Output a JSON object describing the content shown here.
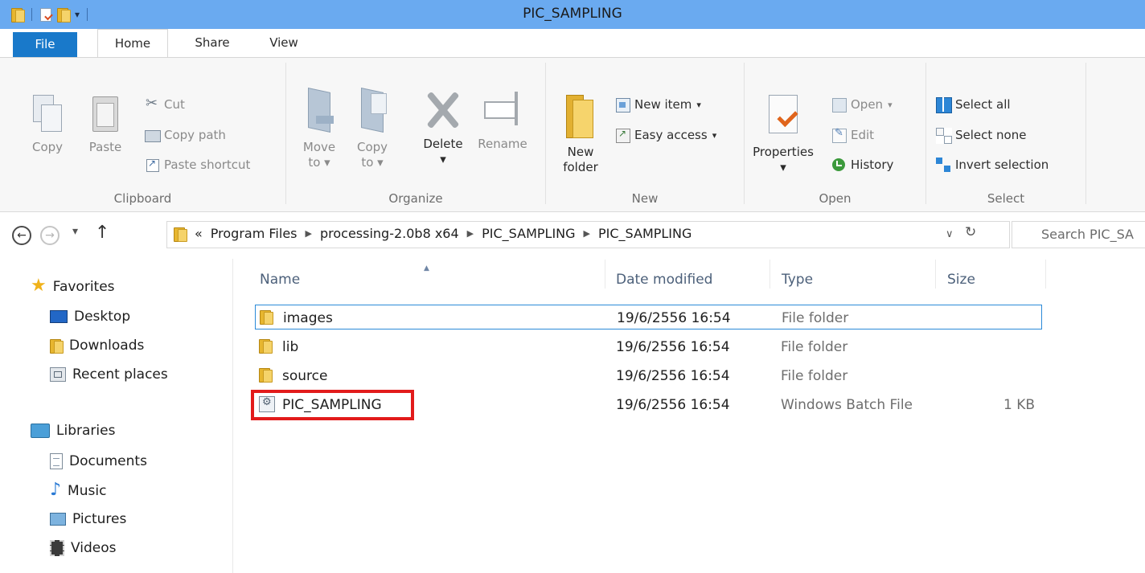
{
  "window": {
    "title": "PIC_SAMPLING"
  },
  "tabs": [
    {
      "label": "File"
    },
    {
      "label": "Home"
    },
    {
      "label": "Share"
    },
    {
      "label": "View"
    }
  ],
  "ribbon": {
    "clipboard": {
      "label": "Clipboard",
      "copy": "Copy",
      "paste": "Paste",
      "cut": "Cut",
      "copy_path": "Copy path",
      "paste_shortcut": "Paste shortcut"
    },
    "organize": {
      "label": "Organize",
      "move_to": [
        "Move",
        "to"
      ],
      "copy_to": [
        "Copy",
        "to"
      ],
      "delete": "Delete",
      "rename": "Rename"
    },
    "new": {
      "label": "New",
      "new_folder": [
        "New",
        "folder"
      ],
      "new_item": "New item",
      "easy_access": "Easy access"
    },
    "open": {
      "label": "Open",
      "properties": "Properties",
      "open": "Open",
      "edit": "Edit",
      "history": "History"
    },
    "select": {
      "label": "Select",
      "select_all": "Select all",
      "select_none": "Select none",
      "invert_selection": "Invert selection"
    }
  },
  "address": {
    "overflow": "«",
    "crumbs": [
      "Program Files",
      "processing-2.0b8 x64",
      "PIC_SAMPLING",
      "PIC_SAMPLING"
    ],
    "search_placeholder": "Search PIC_SA"
  },
  "nav_pane": {
    "favorites": "Favorites",
    "desktop": "Desktop",
    "downloads": "Downloads",
    "recent_places": "Recent places",
    "libraries": "Libraries",
    "documents": "Documents",
    "music": "Music",
    "pictures": "Pictures",
    "videos": "Videos"
  },
  "columns": {
    "name": "Name",
    "date": "Date modified",
    "type": "Type",
    "size": "Size"
  },
  "files": [
    {
      "name": "images",
      "date": "19/6/2556 16:54",
      "type": "File folder",
      "size": ""
    },
    {
      "name": "lib",
      "date": "19/6/2556 16:54",
      "type": "File folder",
      "size": ""
    },
    {
      "name": "source",
      "date": "19/6/2556 16:54",
      "type": "File folder",
      "size": ""
    },
    {
      "name": "PIC_SAMPLING",
      "date": "19/6/2556 16:54",
      "type": "Windows Batch File",
      "size": "1 KB"
    }
  ],
  "colors": {
    "titlebar": "#6aaaf0",
    "file_tab": "#1979ca",
    "highlight": "#e21b1b",
    "selection": "#2b8ad8"
  }
}
